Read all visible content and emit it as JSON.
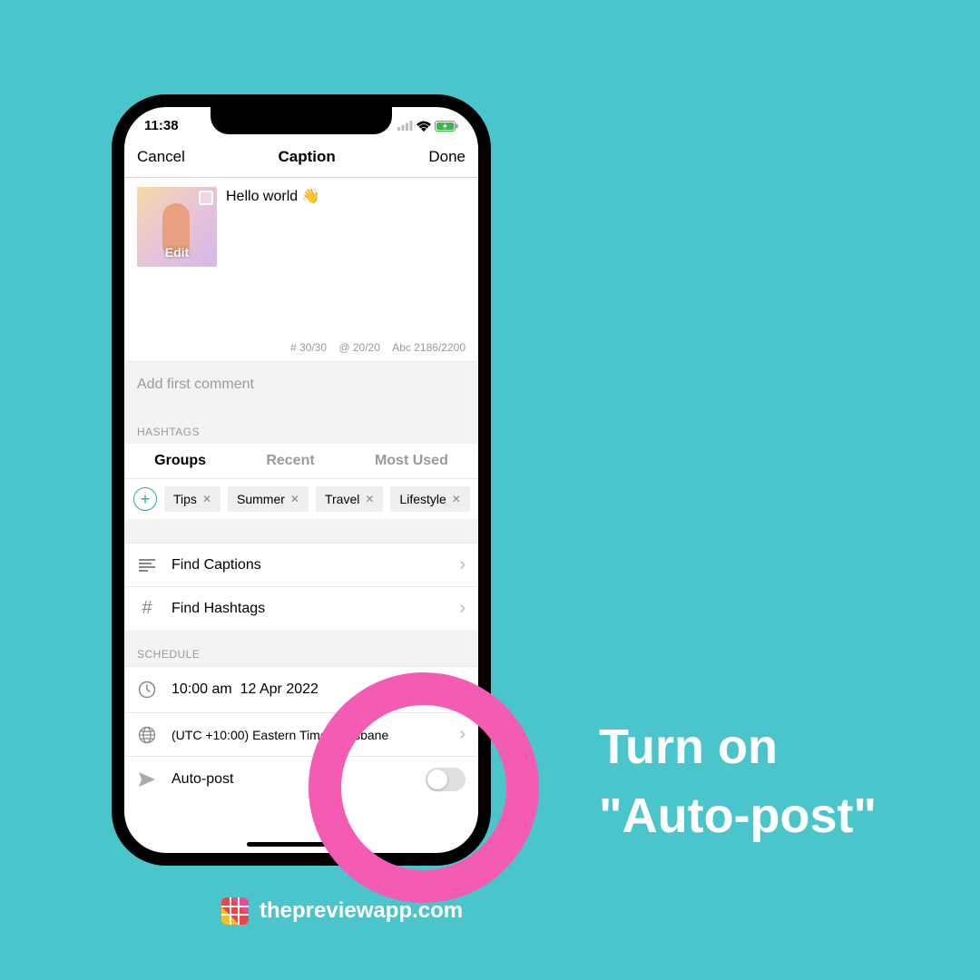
{
  "status": {
    "time": "11:38"
  },
  "nav": {
    "cancel": "Cancel",
    "title": "Caption",
    "done": "Done"
  },
  "caption": {
    "text": "Hello world 👋",
    "edit": "Edit"
  },
  "stats": {
    "hash": "# 30/30",
    "at": "@ 20/20",
    "abc": "Abc 2186/2200"
  },
  "comment": {
    "placeholder": "Add first comment"
  },
  "hashtags": {
    "header": "HASHTAGS",
    "tabs": {
      "groups": "Groups",
      "recent": "Recent",
      "most": "Most Used"
    },
    "tags": [
      "Tips",
      "Summer",
      "Travel",
      "Lifestyle"
    ]
  },
  "rows": {
    "find_captions": "Find Captions",
    "find_hashtags": "Find Hashtags"
  },
  "schedule": {
    "header": "SCHEDULE",
    "time": "10:00 am",
    "date": "12 Apr 2022",
    "tz": "(UTC +10:00) Eastern Time - Brisbane",
    "autopost": "Auto-post"
  },
  "callout": {
    "line1": "Turn on",
    "line2": "\"Auto-post\""
  },
  "footer": {
    "url": "thepreviewapp.com"
  }
}
